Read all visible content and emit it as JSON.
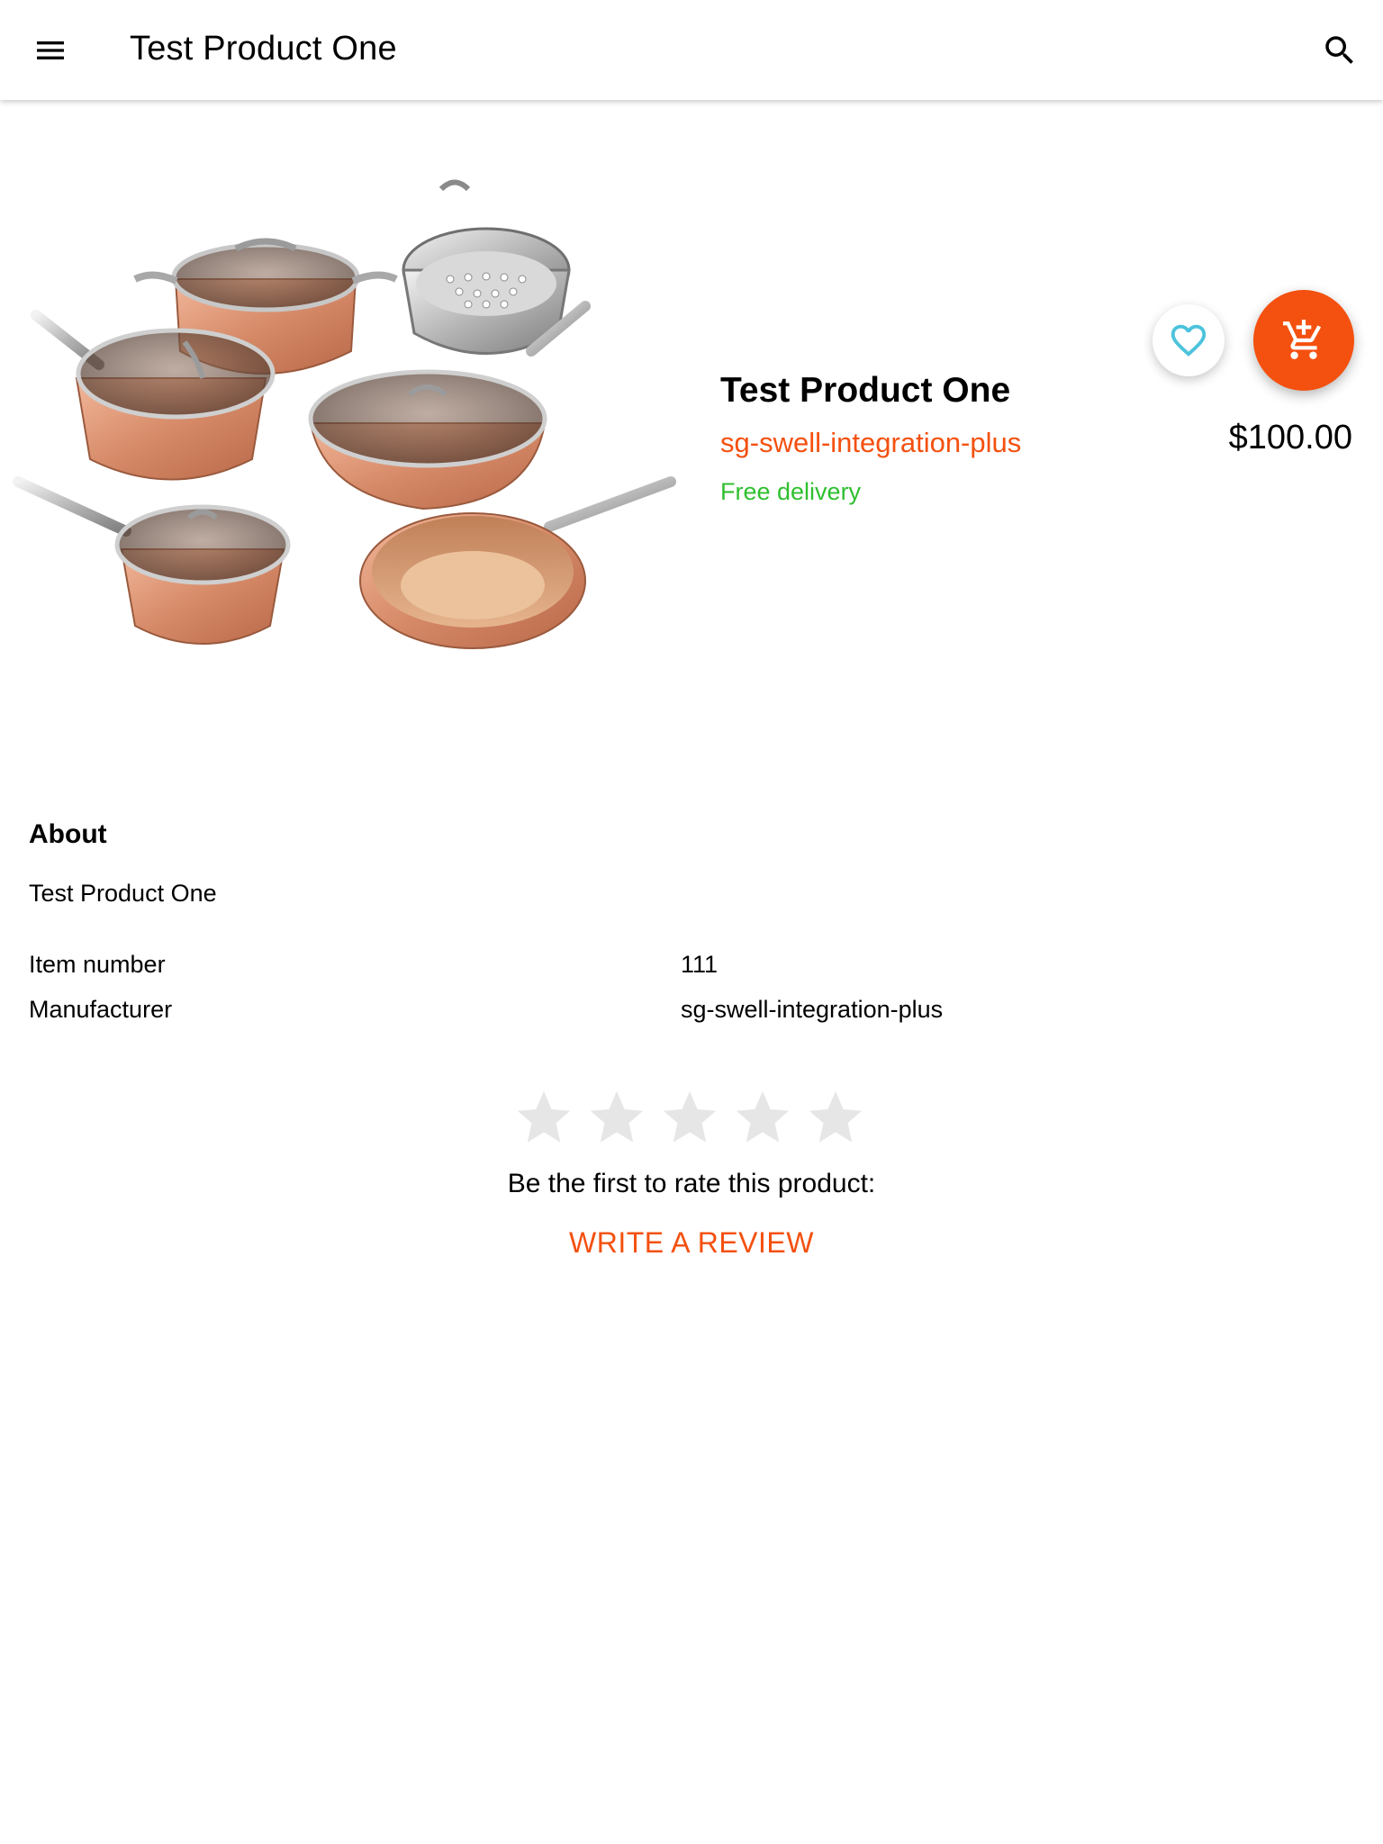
{
  "appbar": {
    "title": "Test Product One",
    "menu_icon": "menu-icon",
    "search_icon": "search-icon"
  },
  "product": {
    "name": "Test Product One",
    "vendor": "sg-swell-integration-plus",
    "delivery": "Free delivery",
    "price": "$100.00",
    "image_subject": "copper cookware set"
  },
  "actions": {
    "favorite_icon": "heart-outline-icon",
    "add_to_cart_icon": "add-shopping-cart-icon"
  },
  "about": {
    "heading": "About",
    "description": "Test Product One",
    "specs": [
      {
        "label": "Item number",
        "value": "111"
      },
      {
        "label": "Manufacturer",
        "value": "sg-swell-integration-plus"
      }
    ]
  },
  "rating": {
    "stars_total": 5,
    "stars_filled": 0,
    "prompt": "Be the first to rate this product:",
    "write_review": "WRITE A REVIEW"
  },
  "colors": {
    "accent": "#f4500f",
    "delivery_green": "#2fbf2f",
    "favorite_cyan": "#4cc3dc",
    "star_empty": "#e6e6e6",
    "text": "#000000"
  }
}
